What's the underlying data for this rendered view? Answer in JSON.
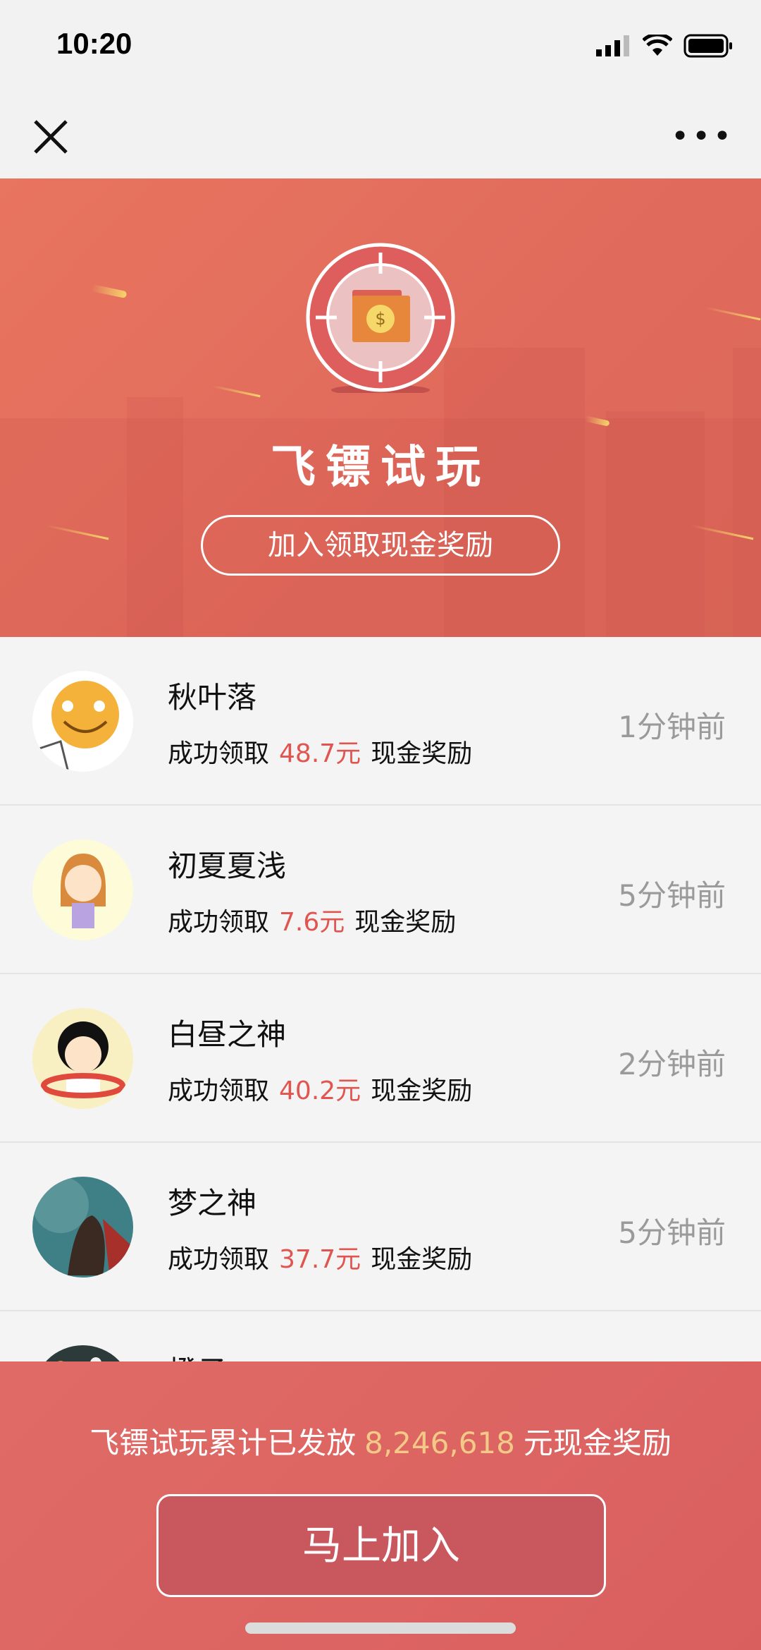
{
  "status_bar": {
    "time": "10:20"
  },
  "nav": {
    "close_icon": "close-icon",
    "more_icon": "more-icon"
  },
  "banner": {
    "title": "飞镖试玩",
    "cta": "加入领取现金奖励"
  },
  "records": [
    {
      "name": "秋叶落",
      "prefix": "成功领取",
      "amount": "48.7元",
      "suffix": "现金奖励",
      "ago": "1分钟前"
    },
    {
      "name": "初夏夏浅",
      "prefix": "成功领取",
      "amount": "7.6元",
      "suffix": "现金奖励",
      "ago": "5分钟前"
    },
    {
      "name": "白昼之神",
      "prefix": "成功领取",
      "amount": "40.2元",
      "suffix": "现金奖励",
      "ago": "2分钟前"
    },
    {
      "name": "梦之神",
      "prefix": "成功领取",
      "amount": "37.7元",
      "suffix": "现金奖励",
      "ago": "5分钟前"
    },
    {
      "name": "橙子"
    }
  ],
  "footer": {
    "summary_prefix": "飞镖试玩累计已发放",
    "total": "8,246,618",
    "summary_suffix": "元现金奖励",
    "join_label": "马上加入"
  },
  "colors": {
    "accent": "#e0554f",
    "banner": "#e4705e",
    "gold": "#f3c987"
  }
}
